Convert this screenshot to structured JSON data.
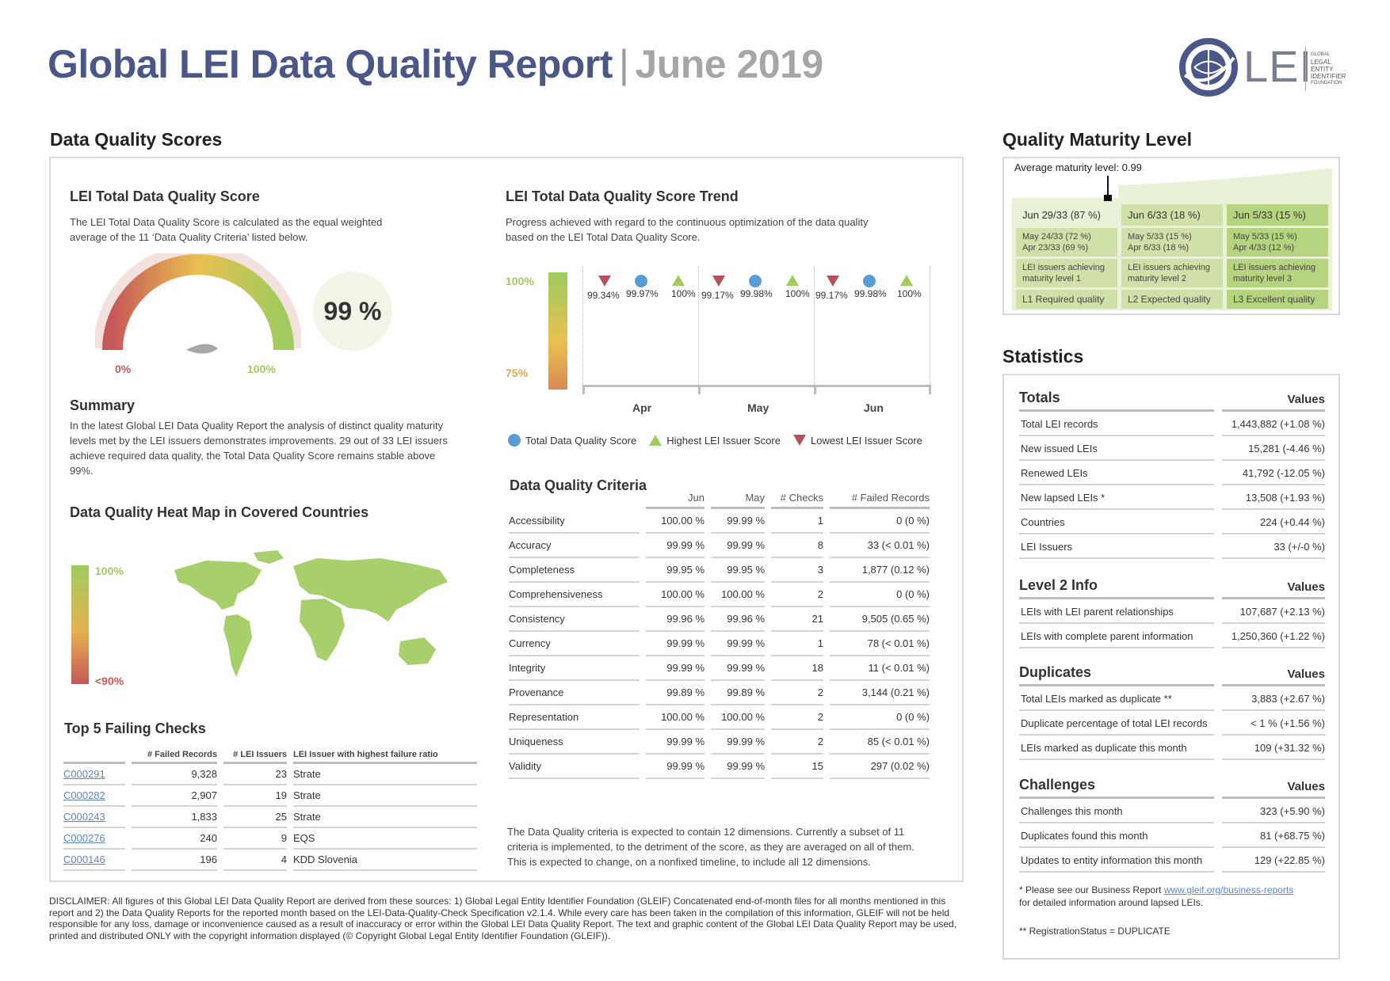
{
  "header": {
    "title": "Global LEI Data Quality Report",
    "separator": "|",
    "month": "June 2019",
    "logo": {
      "icon": "globe-icon",
      "text": "LEI",
      "org_lines": [
        "GLOBAL",
        "LEGAL",
        "ENTITY",
        "IDENTIFIER",
        "FOUNDATION"
      ]
    }
  },
  "dq_scores": {
    "heading": "Data Quality Scores",
    "total_score": {
      "title": "LEI Total Data Quality Score",
      "description": "The LEI Total Data Quality Score is calculated as the equal weighted average of the 11 ‘Data Quality Criteria’ listed below.",
      "gauge_min": "0%",
      "gauge_max": "100%",
      "gauge_value": 0.99,
      "score_label": "99 %"
    },
    "summary": {
      "title": "Summary",
      "text": "In the latest Global LEI Data Quality Report the analysis of distinct quality maturity levels met by the LEI issuers demonstrates improvements. 29 out of 33 LEI issuers achieve required data quality, the Total Data Quality Score remains stable above 99%."
    },
    "heatmap": {
      "title": "Data Quality Heat Map in Covered Countries",
      "scale_top": "100%",
      "scale_bottom": "<90%"
    },
    "top_failing": {
      "title": "Top 5 Failing Checks",
      "headers": [
        "",
        "# Failed Records",
        "# LEI Issuers",
        "LEI Issuer with highest failure ratio"
      ],
      "rows": [
        [
          "C000291",
          "9,328",
          "23",
          "Strate"
        ],
        [
          "C000282",
          "2,907",
          "19",
          "Strate"
        ],
        [
          "C000243",
          "1,833",
          "25",
          "Strate"
        ],
        [
          "C000276",
          "240",
          "9",
          "EQS"
        ],
        [
          "C000146",
          "196",
          "4",
          "KDD Slovenia"
        ]
      ]
    },
    "trend": {
      "title": "LEI Total Data Quality Score Trend",
      "description": "Progress achieved with regard to the continuous optimization of the data quality based on the LEI Total Data Quality Score.",
      "scale_top": "100%",
      "scale_bottom": "75%",
      "months": [
        "Apr",
        "May",
        "Jun"
      ],
      "lowest": [
        "99.34%",
        "99.17%",
        "99.17%"
      ],
      "total": [
        "99.97%",
        "99.98%",
        "99.98%"
      ],
      "highest": [
        "100%",
        "100%",
        "100%"
      ],
      "legend": [
        "Total Data Quality Score",
        "Highest LEI Issuer Score",
        "Lowest LEI Issuer Score"
      ],
      "colors": {
        "total": "#5b9bd5",
        "highest": "#9fcb5f",
        "lowest": "#b5515b"
      }
    },
    "criteria": {
      "title": "Data Quality Criteria",
      "headers": [
        "Jun",
        "May",
        "# Checks",
        "# Failed Records"
      ],
      "rows": [
        [
          "Accessibility",
          "100.00 %",
          "99.99 %",
          "1",
          "0 (0 %)"
        ],
        [
          "Accuracy",
          "99.99 %",
          "99.99 %",
          "8",
          "33 (< 0.01 %)"
        ],
        [
          "Completeness",
          "99.95 %",
          "99.95 %",
          "3",
          "1,877 (0.12 %)"
        ],
        [
          "Comprehensiveness",
          "100.00 %",
          "100.00 %",
          "2",
          "0 (0 %)"
        ],
        [
          "Consistency",
          "99.96 %",
          "99.96 %",
          "21",
          "9,505 (0.65 %)"
        ],
        [
          "Currency",
          "99.99 %",
          "99.99 %",
          "1",
          "78 (< 0.01 %)"
        ],
        [
          "Integrity",
          "99.99 %",
          "99.99 %",
          "18",
          "11 (< 0.01 %)"
        ],
        [
          "Provenance",
          "99.89 %",
          "99.89 %",
          "2",
          "3,144 (0.21 %)"
        ],
        [
          "Representation",
          "100.00 %",
          "100.00 %",
          "2",
          "0 (0 %)"
        ],
        [
          "Uniqueness",
          "99.99 %",
          "99.99 %",
          "2",
          "85 (< 0.01 %)"
        ],
        [
          "Validity",
          "99.99 %",
          "99.99 %",
          "15",
          "297 (0.02 %)"
        ]
      ],
      "note": "The Data Quality criteria is expected to contain 12 dimensions. Currently a subset of 11 criteria is implemented, to the detriment of the score, as they are averaged on all of them. This is expected to change, on a nonfixed timeline, to include all 12 dimensions."
    }
  },
  "maturity": {
    "heading": "Quality Maturity Level",
    "average": "Average maturity level: 0.99",
    "columns": [
      {
        "head": "Jun 29/33 (87 %)",
        "history": [
          "May 24/33 (72 %)",
          "Apr 23/33 (69 %)"
        ],
        "issuers": "LEI issuers achieving maturity level 1",
        "level": "L1 Required quality"
      },
      {
        "head": "Jun 6/33 (18 %)",
        "history": [
          "May 5/33 (15 %)",
          "Apr 6/33 (18 %)"
        ],
        "issuers": "LEI issuers achieving maturity level 2",
        "level": "L2 Expected quality"
      },
      {
        "head": "Jun 5/33 (15 %)",
        "history": [
          "May 5/33 (15 %)",
          "Apr 4/33 (12 %)"
        ],
        "issuers": "LEI issuers achieving maturity level 3",
        "level": "L3 Excellent quality"
      }
    ]
  },
  "statistics": {
    "heading": "Statistics",
    "values_label": "Values",
    "totals": {
      "title": "Totals",
      "rows": [
        [
          "Total LEI records",
          "1,443,882 (+1.08 %)"
        ],
        [
          "New issued LEIs",
          "15,281 (-4.46 %)"
        ],
        [
          "Renewed LEIs",
          "41,792 (-12.05 %)"
        ],
        [
          "New lapsed LEIs *",
          "13,508 (+1.93 %)"
        ],
        [
          "Countries",
          "224 (+0.44 %)"
        ],
        [
          "LEI Issuers",
          "33 (+/-0 %)"
        ]
      ]
    },
    "level2": {
      "title": "Level 2 Info",
      "rows": [
        [
          "LEIs with LEI parent relationships",
          "107,687 (+2.13 %)"
        ],
        [
          "LEIs with complete parent information",
          "1,250,360 (+1.22 %)"
        ]
      ]
    },
    "duplicates": {
      "title": "Duplicates",
      "rows": [
        [
          "Total LEIs marked as duplicate **",
          "3,883 (+2.67 %)"
        ],
        [
          "Duplicate percentage of total LEI records",
          "< 1 % (+1.56 %)"
        ],
        [
          "LEIs marked as duplicate this month",
          "109 (+31.32 %)"
        ]
      ]
    },
    "challenges": {
      "title": "Challenges",
      "rows": [
        [
          "Challenges this month",
          "323 (+5.90 %)"
        ],
        [
          "Duplicates found this month",
          "81 (+68.75 %)"
        ],
        [
          "Updates to entity information this month",
          "129 (+22.85 %)"
        ]
      ]
    },
    "footnote1_prefix": "* Please see our Business Report ",
    "footnote1_link": "www.gleif.org/business-reports",
    "footnote1_suffix": "for detailed information around lapsed LEIs.",
    "footnote2": "** RegistrationStatus = DUPLICATE"
  },
  "disclaimer": "DISCLAIMER: All figures of this Global LEI Data Quality Report are derived from these sources: 1) Global Legal Entity Identifier Foundation (GLEIF) Concatenated end-of-month files for all months mentioned in this report and 2) the Data Quality Reports for the reported month based on the LEI-Data-Quality-Check Specification v2.1.4. While every care has been taken in the compilation of this information, GLEIF will not be held responsible for any loss, damage or inconvenience caused as a result of inaccuracy or error within the Global LEI Data Quality Report. The text and graphic content of the Global LEI Data Quality Report may be used, printed and distributed ONLY with the copyright information displayed (© Copyright Global Legal Entity Identifier Foundation (GLEIF))."
}
